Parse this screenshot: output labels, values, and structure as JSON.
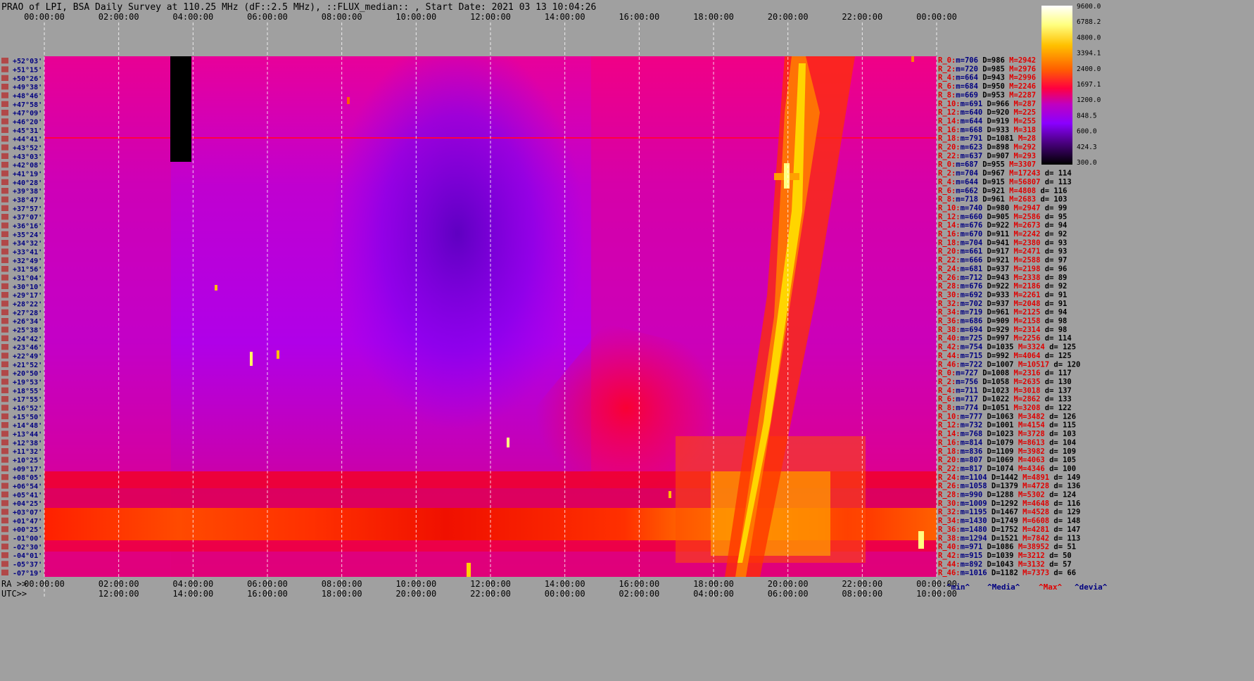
{
  "title": "PRAO of LPI, BSA Daily Survey at 110.25 MHz (dF::2.5 MHz), ::FLUX_median:: , Start Date: 2021 03 13 10:04:26",
  "chart_data": {
    "type": "heatmap",
    "top_axis_labels": [
      "00:00:00",
      "02:00:00",
      "04:00:00",
      "06:00:00",
      "08:00:00",
      "10:00:00",
      "12:00:00",
      "14:00:00",
      "16:00:00",
      "18:00:00",
      "20:00:00",
      "22:00:00",
      "00:00:00"
    ],
    "bottom_ra_prefix": "RA >>",
    "bottom_ra_labels": [
      "00:00:00",
      "02:00:00",
      "04:00:00",
      "06:00:00",
      "08:00:00",
      "10:00:00",
      "12:00:00",
      "14:00:00",
      "16:00:00",
      "18:00:00",
      "20:00:00",
      "22:00:00",
      "00:00:00"
    ],
    "bottom_utc_prefix": "UTC>>",
    "bottom_utc_labels": [
      "12:00:00",
      "14:00:00",
      "16:00:00",
      "18:00:00",
      "20:00:00",
      "22:00:00",
      "00:00:00",
      "02:00:00",
      "04:00:00",
      "06:00:00",
      "08:00:00",
      "10:00:00"
    ],
    "colorbar_ticks": [
      "9600.0",
      "6788.2",
      "4800.0",
      "3394.1",
      "2400.0",
      "1697.1",
      "1200.0",
      "848.5",
      "600.0",
      "424.3",
      "300.0"
    ],
    "declinations": [
      "+52°03'",
      "+51°15'",
      "+50°26'",
      "+49°38'",
      "+48°46'",
      "+47°58'",
      "+47°09'",
      "+46°20'",
      "+45°31'",
      "+44°41'",
      "+43°52'",
      "+43°03'",
      "+42°08'",
      "+41°19'",
      "+40°28'",
      "+39°38'",
      "+38°47'",
      "+37°57'",
      "+37°07'",
      "+36°16'",
      "+35°24'",
      "+34°32'",
      "+33°41'",
      "+32°49'",
      "+31°56'",
      "+31°04'",
      "+30°10'",
      "+29°17'",
      "+28°22'",
      "+27°28'",
      "+26°34'",
      "+25°38'",
      "+24°42'",
      "+23°46'",
      "+22°49'",
      "+21°52'",
      "+20°50'",
      "+19°53'",
      "+18°55'",
      "+17°55'",
      "+16°52'",
      "+15°50'",
      "+14°48'",
      "+13°44'",
      "+12°38'",
      "+11°32'",
      "+10°25'",
      "+09°17'",
      "+08°05'",
      "+06°54'",
      "+05°41'",
      "+04°25'",
      "+03°07'",
      "+01°47'",
      "+00°25'",
      "-01°00'",
      "-02°30'",
      "-04°01'",
      "-05°37'",
      "-07°19'"
    ],
    "stats": [
      {
        "r": "R_0:",
        "m": "706",
        "d": "986",
        "h": "2942",
        "dev": ""
      },
      {
        "r": "R_2:",
        "m": "720",
        "d": "985",
        "h": "2976",
        "dev": ""
      },
      {
        "r": "R_4:",
        "m": "664",
        "d": "943",
        "h": "2996",
        "dev": ""
      },
      {
        "r": "R_6:",
        "m": "684",
        "d": "950",
        "h": "2246",
        "dev": ""
      },
      {
        "r": "R_8:",
        "m": "669",
        "d": "953",
        "h": "2287",
        "dev": ""
      },
      {
        "r": "R_10:",
        "m": "691",
        "d": "966",
        "h": "287",
        "dev": ""
      },
      {
        "r": "R_12:",
        "m": "640",
        "d": "920",
        "h": "225",
        "dev": ""
      },
      {
        "r": "R_14:",
        "m": "644",
        "d": "919",
        "h": "255",
        "dev": ""
      },
      {
        "r": "R_16:",
        "m": "668",
        "d": "933",
        "h": "318",
        "dev": ""
      },
      {
        "r": "R_18:",
        "m": "791",
        "d": "1081",
        "h": "28",
        "dev": ""
      },
      {
        "r": "R_20:",
        "m": "623",
        "d": "898",
        "h": "292",
        "dev": ""
      },
      {
        "r": "R_22:",
        "m": "637",
        "d": "907",
        "h": "293",
        "dev": ""
      },
      {
        "r": "R_0:",
        "m": "687",
        "d": "955",
        "h": "3307",
        "dev": ""
      },
      {
        "r": "R_2:",
        "m": "704",
        "d": "967",
        "h": "17243",
        "dev": "114"
      },
      {
        "r": "R_4:",
        "m": "644",
        "d": "915",
        "h": "56807",
        "dev": "113"
      },
      {
        "r": "R_6:",
        "m": "662",
        "d": "921",
        "h": "4808",
        "dev": "116"
      },
      {
        "r": "R_8:",
        "m": "718",
        "d": "961",
        "h": "2683",
        "dev": "103"
      },
      {
        "r": "R_10:",
        "m": "740",
        "d": "980",
        "h": "2947",
        "dev": "99"
      },
      {
        "r": "R_12:",
        "m": "660",
        "d": "905",
        "h": "2586",
        "dev": "95"
      },
      {
        "r": "R_14:",
        "m": "676",
        "d": "922",
        "h": "2673",
        "dev": "94"
      },
      {
        "r": "R_16:",
        "m": "670",
        "d": "911",
        "h": "2242",
        "dev": "92"
      },
      {
        "r": "R_18:",
        "m": "704",
        "d": "941",
        "h": "2380",
        "dev": "93"
      },
      {
        "r": "R_20:",
        "m": "661",
        "d": "917",
        "h": "2471",
        "dev": "93"
      },
      {
        "r": "R_22:",
        "m": "666",
        "d": "921",
        "h": "2588",
        "dev": "97"
      },
      {
        "r": "R_24:",
        "m": "681",
        "d": "937",
        "h": "2198",
        "dev": "96"
      },
      {
        "r": "R_26:",
        "m": "712",
        "d": "943",
        "h": "2338",
        "dev": "89"
      },
      {
        "r": "R_28:",
        "m": "676",
        "d": "922",
        "h": "2186",
        "dev": "92"
      },
      {
        "r": "R_30:",
        "m": "692",
        "d": "933",
        "h": "2261",
        "dev": "91"
      },
      {
        "r": "R_32:",
        "m": "702",
        "d": "937",
        "h": "2048",
        "dev": "91"
      },
      {
        "r": "R_34:",
        "m": "719",
        "d": "961",
        "h": "2125",
        "dev": "94"
      },
      {
        "r": "R_36:",
        "m": "686",
        "d": "909",
        "h": "2158",
        "dev": "98"
      },
      {
        "r": "R_38:",
        "m": "694",
        "d": "929",
        "h": "2314",
        "dev": "98"
      },
      {
        "r": "R_40:",
        "m": "725",
        "d": "997",
        "h": "2256",
        "dev": "114"
      },
      {
        "r": "R_42:",
        "m": "754",
        "d": "1035",
        "h": "3324",
        "dev": "125"
      },
      {
        "r": "R_44:",
        "m": "715",
        "d": "992",
        "h": "4064",
        "dev": "125"
      },
      {
        "r": "R_46:",
        "m": "722",
        "d": "1007",
        "h": "10517",
        "dev": "120"
      },
      {
        "r": "R_0:",
        "m": "727",
        "d": "1008",
        "h": "2316",
        "dev": "117"
      },
      {
        "r": "R_2:",
        "m": "756",
        "d": "1058",
        "h": "2635",
        "dev": "130"
      },
      {
        "r": "R_4:",
        "m": "711",
        "d": "1023",
        "h": "3018",
        "dev": "137"
      },
      {
        "r": "R_6:",
        "m": "717",
        "d": "1022",
        "h": "2862",
        "dev": "133"
      },
      {
        "r": "R_8:",
        "m": "774",
        "d": "1051",
        "h": "3208",
        "dev": "122"
      },
      {
        "r": "R_10:",
        "m": "777",
        "d": "1063",
        "h": "3482",
        "dev": "126"
      },
      {
        "r": "R_12:",
        "m": "732",
        "d": "1001",
        "h": "4154",
        "dev": "115"
      },
      {
        "r": "R_14:",
        "m": "768",
        "d": "1023",
        "h": "3728",
        "dev": "103"
      },
      {
        "r": "R_16:",
        "m": "814",
        "d": "1079",
        "h": "8613",
        "dev": "104"
      },
      {
        "r": "R_18:",
        "m": "836",
        "d": "1109",
        "h": "3982",
        "dev": "109"
      },
      {
        "r": "R_20:",
        "m": "807",
        "d": "1069",
        "h": "4063",
        "dev": "105"
      },
      {
        "r": "R_22:",
        "m": "817",
        "d": "1074",
        "h": "4346",
        "dev": "100"
      },
      {
        "r": "R_24:",
        "m": "1104",
        "d": "1442",
        "h": "4891",
        "dev": "149"
      },
      {
        "r": "R_26:",
        "m": "1058",
        "d": "1379",
        "h": "4728",
        "dev": "136"
      },
      {
        "r": "R_28:",
        "m": "990",
        "d": "1288",
        "h": "5302",
        "dev": "124"
      },
      {
        "r": "R_30:",
        "m": "1009",
        "d": "1292",
        "h": "4648",
        "dev": "116"
      },
      {
        "r": "R_32:",
        "m": "1195",
        "d": "1467",
        "h": "4528",
        "dev": "129"
      },
      {
        "r": "R_34:",
        "m": "1430",
        "d": "1749",
        "h": "6608",
        "dev": "148"
      },
      {
        "r": "R_36:",
        "m": "1480",
        "d": "1752",
        "h": "4281",
        "dev": "147"
      },
      {
        "r": "R_38:",
        "m": "1294",
        "d": "1521",
        "h": "7842",
        "dev": "113"
      },
      {
        "r": "R_40:",
        "m": "971",
        "d": "1086",
        "h": "38952",
        "dev": "51"
      },
      {
        "r": "R_42:",
        "m": "915",
        "d": "1039",
        "h": "3212",
        "dev": "50"
      },
      {
        "r": "R_44:",
        "m": "892",
        "d": "1043",
        "h": "3132",
        "dev": "57"
      },
      {
        "r": "R_46:",
        "m": "1016",
        "d": "1182",
        "h": "7373",
        "dev": "66"
      }
    ],
    "stats_legend": [
      "^min^",
      "^Media^",
      "^Max^",
      "^devia^"
    ],
    "colors": {
      "background": "#a0a0a0",
      "dark_blue": "#000080",
      "red": "#e00000",
      "grid_dash": "#ffffff",
      "colormap": [
        "#000000",
        "#4b0082",
        "#8a00ff",
        "#c000c0",
        "#ff0040",
        "#ff3000",
        "#ff8000",
        "#ffc000",
        "#ffff80",
        "#ffffff"
      ]
    }
  }
}
